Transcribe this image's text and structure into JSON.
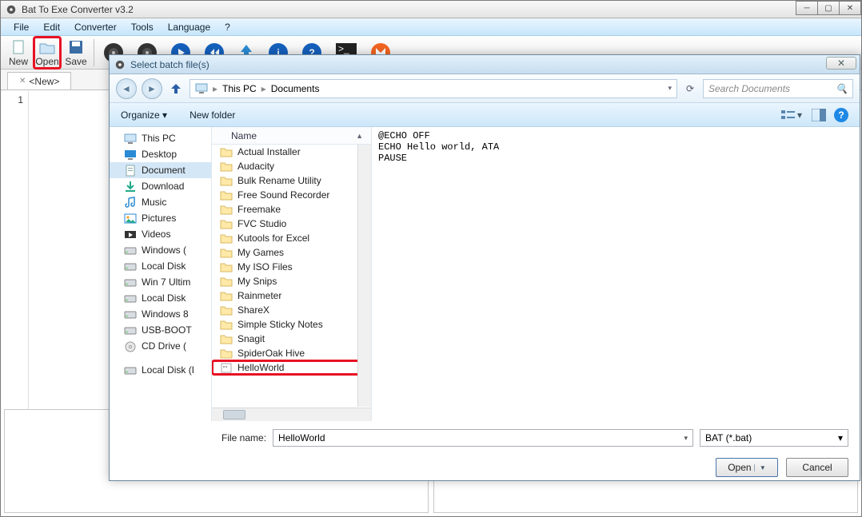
{
  "window": {
    "title": "Bat To Exe Converter v3.2"
  },
  "menu": {
    "file": "File",
    "edit": "Edit",
    "converter": "Converter",
    "tools": "Tools",
    "language": "Language",
    "help": "?"
  },
  "toolbar": {
    "new": "New",
    "open": "Open",
    "save": "Save"
  },
  "tab": {
    "name": "<New>"
  },
  "gutter": {
    "line1": "1"
  },
  "dialog": {
    "title": "Select batch file(s)",
    "path": {
      "root": "This PC",
      "folder": "Documents"
    },
    "search_placeholder": "Search Documents",
    "organize": "Organize",
    "newfolder": "New folder",
    "col_name": "Name",
    "tree": [
      {
        "label": "This PC",
        "icon": "pc"
      },
      {
        "label": "Desktop",
        "icon": "desktop"
      },
      {
        "label": "Document",
        "icon": "docs",
        "sel": true
      },
      {
        "label": "Download",
        "icon": "download"
      },
      {
        "label": "Music",
        "icon": "music"
      },
      {
        "label": "Pictures",
        "icon": "pics"
      },
      {
        "label": "Videos",
        "icon": "videos"
      },
      {
        "label": "Windows (",
        "icon": "disk"
      },
      {
        "label": "Local Disk",
        "icon": "disk"
      },
      {
        "label": "Win 7 Ultim",
        "icon": "disk"
      },
      {
        "label": "Local Disk",
        "icon": "disk"
      },
      {
        "label": "Windows 8",
        "icon": "disk"
      },
      {
        "label": "USB-BOOT",
        "icon": "disk"
      },
      {
        "label": "CD Drive (",
        "icon": "cd"
      },
      {
        "label": "Local Disk (I",
        "icon": "disk"
      }
    ],
    "files": [
      {
        "label": "Actual Installer",
        "type": "folder"
      },
      {
        "label": "Audacity",
        "type": "folder"
      },
      {
        "label": "Bulk Rename Utility",
        "type": "folder"
      },
      {
        "label": "Free Sound Recorder",
        "type": "folder"
      },
      {
        "label": "Freemake",
        "type": "folder"
      },
      {
        "label": "FVC Studio",
        "type": "folder"
      },
      {
        "label": "Kutools for Excel",
        "type": "folder"
      },
      {
        "label": "My Games",
        "type": "folder"
      },
      {
        "label": "My ISO Files",
        "type": "folder"
      },
      {
        "label": "My Snips",
        "type": "folder"
      },
      {
        "label": "Rainmeter",
        "type": "folder"
      },
      {
        "label": "ShareX",
        "type": "folder"
      },
      {
        "label": "Simple Sticky Notes",
        "type": "folder"
      },
      {
        "label": "Snagit",
        "type": "folder"
      },
      {
        "label": "SpiderOak Hive",
        "type": "folder"
      },
      {
        "label": "HelloWorld",
        "type": "bat",
        "sel": true
      }
    ],
    "preview": "@ECHO OFF\nECHO Hello world, ATA\nPAUSE",
    "filename_label": "File name:",
    "filename_value": "HelloWorld",
    "filetype": "BAT (*.bat)",
    "open_btn": "Open",
    "cancel_btn": "Cancel"
  }
}
